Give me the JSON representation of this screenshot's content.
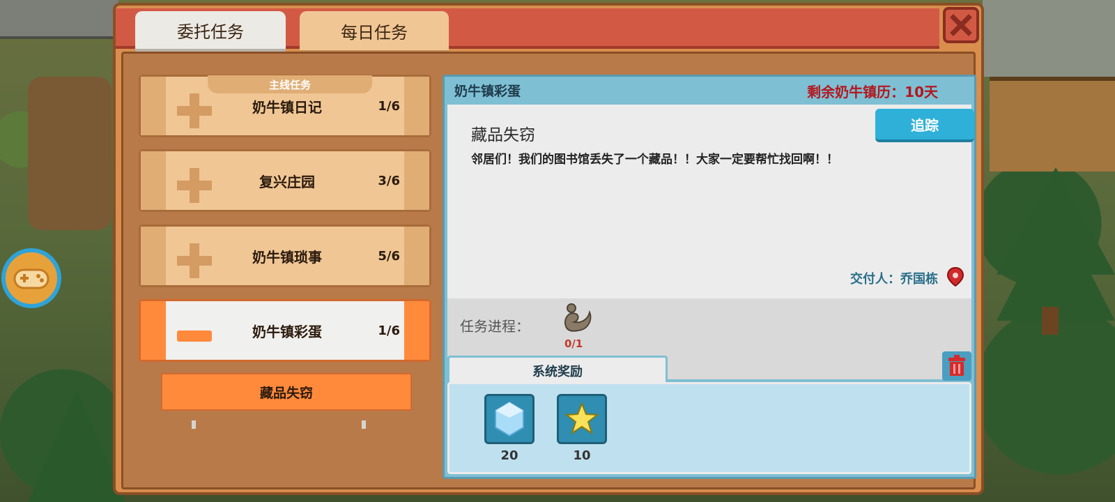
{
  "tabs": {
    "commission": "委托任务",
    "daily": "每日任务"
  },
  "quest_list": {
    "main_tag": "主线任务",
    "items": [
      {
        "name": "奶牛镇日记",
        "count": "1/6"
      },
      {
        "name": "复兴庄园",
        "count": "3/6"
      },
      {
        "name": "奶牛镇琐事",
        "count": "5/6"
      },
      {
        "name": "奶牛镇彩蛋",
        "count": "1/6"
      }
    ],
    "sub_item": "藏品失窃"
  },
  "detail": {
    "title": "奶牛镇彩蛋",
    "remaining": "剩余奶牛镇历：10天",
    "quest_name": "藏品失窃",
    "description": "邻居们！我们的图书馆丢失了一个藏品！！大家一定要帮忙找回啊！！",
    "track_label": "追踪",
    "giver": "交付人：乔国栋",
    "progress_label": "任务进程：",
    "progress_count": "0/1",
    "reward_tab": "系统奖励",
    "rewards": [
      {
        "icon": "crystal-icon",
        "count": "20"
      },
      {
        "icon": "star-icon",
        "count": "10"
      }
    ]
  },
  "colors": {
    "accent_orange": "#ff8a3c",
    "header_red": "#d25a45",
    "panel_tan": "#d98e4e",
    "detail_blue": "#7ebfd4",
    "remaining_red": "#b3171d"
  }
}
